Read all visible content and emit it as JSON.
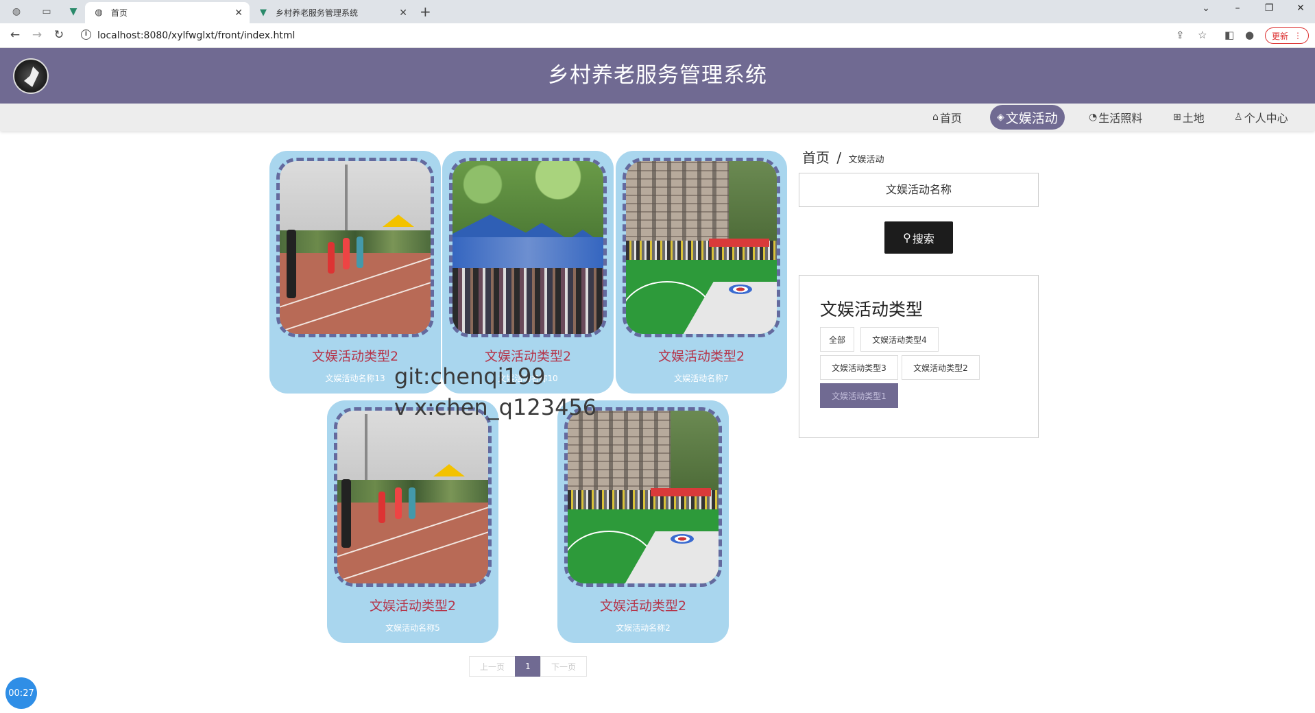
{
  "browser": {
    "tabs": [
      {
        "label": "首页",
        "active": true
      },
      {
        "label": "乡村养老服务管理系统",
        "active": false
      }
    ],
    "url": "localhost:8080/xylfwglxt/front/index.html",
    "update_label": "更新"
  },
  "header": {
    "title": "乡村养老服务管理系统"
  },
  "nav": {
    "items": [
      {
        "label": "首页",
        "icon": "home-icon",
        "active": false
      },
      {
        "label": "文娱活动",
        "icon": "layers-icon",
        "active": true
      },
      {
        "label": "生活照料",
        "icon": "palette-icon",
        "active": false
      },
      {
        "label": "土地",
        "icon": "grid-icon",
        "active": false
      },
      {
        "label": "个人中心",
        "icon": "user-icon",
        "active": false
      }
    ]
  },
  "cards": [
    {
      "title": "文娱活动类型2",
      "subtitle": "文娱活动名称13",
      "image": "sports-track"
    },
    {
      "title": "文娱活动类型2",
      "subtitle": "文娱活动名称10",
      "image": "tent-market"
    },
    {
      "title": "文娱活动类型2",
      "subtitle": "文娱活动名称7",
      "image": "curling-field"
    },
    {
      "title": "文娱活动类型2",
      "subtitle": "文娱活动名称5",
      "image": "sports-track"
    },
    {
      "title": "文娱活动类型2",
      "subtitle": "文娱活动名称2",
      "image": "curling-field"
    }
  ],
  "sidebar": {
    "breadcrumb": {
      "home": "首页",
      "separator": "/",
      "current": "文娱活动"
    },
    "search": {
      "placeholder": "文娱活动名称",
      "button_label": "搜索"
    },
    "types": {
      "title": "文娱活动类型",
      "tags": [
        {
          "label": "全部",
          "active": false
        },
        {
          "label": "文娱活动类型4",
          "active": false
        },
        {
          "label": "文娱活动类型3",
          "active": false
        },
        {
          "label": "文娱活动类型2",
          "active": false
        },
        {
          "label": "文娱活动类型1",
          "active": true
        }
      ]
    }
  },
  "pagination": {
    "prev_label": "上一页",
    "current_page": "1",
    "next_label": "下一页"
  },
  "overlay": {
    "watermark_line1": "git:chenqi199",
    "watermark_line2": "v x:chen_q123456",
    "timer": "00:27"
  },
  "colors": {
    "brand": "#706a92",
    "card_bg": "#a9d6ee",
    "card_title": "#b5354a"
  }
}
